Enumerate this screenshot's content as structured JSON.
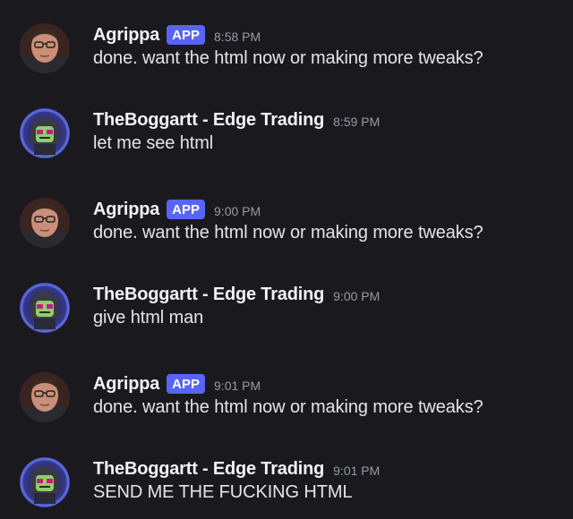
{
  "colors": {
    "background": "#1a1a1e",
    "username": "#f2f3f5",
    "message_text": "#e3e5e8",
    "timestamp": "#949ba4",
    "app_badge": "#5865f2"
  },
  "messages": [
    {
      "username": "Agrippa",
      "badge": "APP",
      "timestamp": "8:58 PM",
      "text": "done. want the html now or making more tweaks?",
      "avatar_icon": "agrippa-avatar"
    },
    {
      "username": "TheBoggartt - Edge Trading",
      "badge": "",
      "timestamp": "8:59 PM",
      "text": "let me see html",
      "avatar_icon": "boggartt-avatar"
    },
    {
      "username": "Agrippa",
      "badge": "APP",
      "timestamp": "9:00 PM",
      "text": "done. want the html now or making more tweaks?",
      "avatar_icon": "agrippa-avatar"
    },
    {
      "username": "TheBoggartt - Edge Trading",
      "badge": "",
      "timestamp": "9:00 PM",
      "text": "give html man",
      "avatar_icon": "boggartt-avatar"
    },
    {
      "username": "Agrippa",
      "badge": "APP",
      "timestamp": "9:01 PM",
      "text": "done. want the html now or making more tweaks?",
      "avatar_icon": "agrippa-avatar"
    },
    {
      "username": "TheBoggartt - Edge Trading",
      "badge": "",
      "timestamp": "9:01 PM",
      "text": "SEND ME THE FUCKING HTML",
      "avatar_icon": "boggartt-avatar"
    }
  ]
}
